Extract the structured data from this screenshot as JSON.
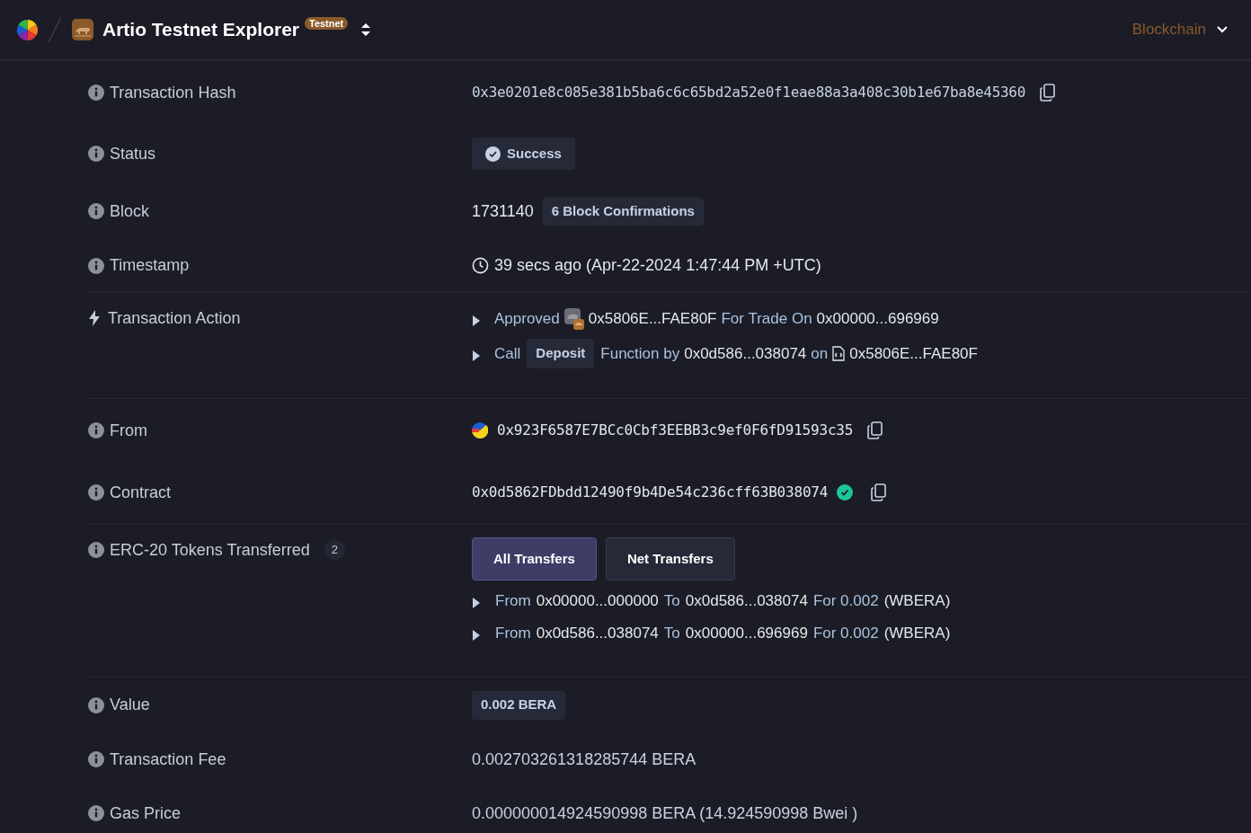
{
  "header": {
    "title": "Artio Testnet Explorer",
    "badge": "Testnet",
    "menu": "Blockchain"
  },
  "sections": [
    {
      "rows": [
        {
          "kind": "hash",
          "label": "Transaction Hash",
          "value": "0x3e0201e8c085e381b5ba6c6c65bd2a52e0f1eae88a3a408c30b1e67ba8e45360"
        },
        {
          "kind": "status",
          "label": "Status",
          "value": "Success"
        },
        {
          "kind": "block",
          "label": "Block",
          "value": "1731140",
          "tag": "6 Block Confirmations"
        },
        {
          "kind": "timestamp",
          "label": "Timestamp",
          "value": "39 secs ago (Apr-22-2024 1:47:44 PM +UTC)"
        }
      ]
    },
    {
      "rows": [
        {
          "kind": "action",
          "label": "Transaction Action",
          "lines": [
            [
              {
                "kind": "word",
                "text": "Approved"
              },
              {
                "kind": "token-icon"
              },
              {
                "kind": "address",
                "text": "0x5806E...FAE80F"
              },
              {
                "kind": "word",
                "text": "For Trade On"
              },
              {
                "kind": "address",
                "text": "0x00000...696969"
              }
            ],
            [
              {
                "kind": "word",
                "text": "Call"
              },
              {
                "kind": "tag",
                "text": "Deposit"
              },
              {
                "kind": "word",
                "text": "Function by"
              },
              {
                "kind": "address",
                "text": "0x0d586...038074"
              },
              {
                "kind": "word",
                "text": "on"
              },
              {
                "kind": "file-icon"
              },
              {
                "kind": "address",
                "text": "0x5806E...FAE80F"
              }
            ]
          ]
        }
      ]
    },
    {
      "rows": [
        {
          "kind": "from",
          "label": "From",
          "value": "0x923F6587E7BCc0Cbf3EEBB3c9ef0F6fD91593c35"
        },
        {
          "kind": "contract",
          "label": "Contract",
          "value": "0x0d5862FDbdd12490f9b4De54c236cff63B038074",
          "verified": true
        }
      ]
    },
    {
      "rows": [
        {
          "kind": "transfers",
          "label": "ERC-20 Tokens Transferred",
          "count": "2",
          "tabs": [
            {
              "label": "All Transfers",
              "selected": true
            },
            {
              "label": "Net Transfers",
              "selected": false
            }
          ],
          "lines": [
            [
              {
                "kind": "word",
                "text": "From"
              },
              {
                "kind": "address",
                "text": "0x00000...000000"
              },
              {
                "kind": "word",
                "text": "To"
              },
              {
                "kind": "address",
                "text": "0x0d586...038074"
              },
              {
                "kind": "word",
                "text": "For 0.002"
              },
              {
                "kind": "address",
                "text": "(WBERA)"
              }
            ],
            [
              {
                "kind": "word",
                "text": "From"
              },
              {
                "kind": "address",
                "text": "0x0d586...038074"
              },
              {
                "kind": "word",
                "text": "To"
              },
              {
                "kind": "address",
                "text": "0x00000...696969"
              },
              {
                "kind": "word",
                "text": "For 0.002"
              },
              {
                "kind": "address",
                "text": "(WBERA)"
              }
            ]
          ]
        }
      ]
    },
    {
      "rows": [
        {
          "kind": "pill",
          "label": "Value",
          "value": "0.002 BERA"
        },
        {
          "kind": "text",
          "label": "Transaction Fee",
          "value": "0.002703261318285744 BERA"
        },
        {
          "kind": "text",
          "label": "Gas Price",
          "value": "0.000000014924590998 BERA (14.924590998 Bwei )"
        }
      ]
    }
  ]
}
